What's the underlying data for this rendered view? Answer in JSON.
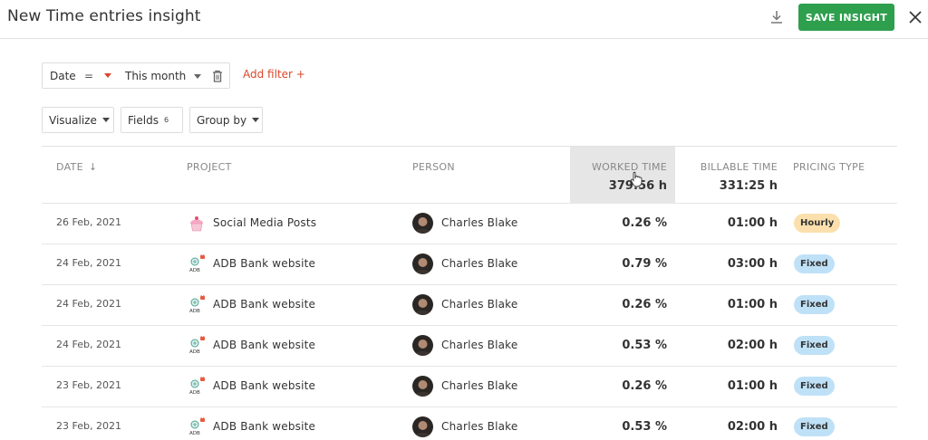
{
  "header": {
    "title": "New Time entries insight",
    "save_label": "SAVE INSIGHT",
    "download_icon": "download-icon",
    "close_icon": "close-icon"
  },
  "filter": {
    "field": "Date",
    "operator": "=",
    "value": "This month",
    "add_filter_label": "Add filter +"
  },
  "toolbar": {
    "visualize_label": "Visualize",
    "fields_label": "Fields",
    "fields_count": "6",
    "group_by_label": "Group by"
  },
  "table": {
    "columns": {
      "date": "DATE",
      "project": "PROJECT",
      "person": "PERSON",
      "worked_time": "WORKED TIME",
      "billable_time": "BILLABLE TIME",
      "pricing_type": "PRICING TYPE"
    },
    "totals": {
      "worked_time": "379:56 h",
      "billable_time": "331:25 h"
    },
    "rows": [
      {
        "date": "26 Feb, 2021",
        "project": "Social Media Posts",
        "project_icon": "cupcake-icon",
        "person": "Charles Blake",
        "worked": "0.26 %",
        "billable": "01:00 h",
        "pricing": "Hourly"
      },
      {
        "date": "24 Feb, 2021",
        "project": "ADB Bank website",
        "project_icon": "adb-logo-icon",
        "person": "Charles Blake",
        "worked": "0.79 %",
        "billable": "03:00 h",
        "pricing": "Fixed"
      },
      {
        "date": "24 Feb, 2021",
        "project": "ADB Bank website",
        "project_icon": "adb-logo-icon",
        "person": "Charles Blake",
        "worked": "0.26 %",
        "billable": "01:00 h",
        "pricing": "Fixed"
      },
      {
        "date": "24 Feb, 2021",
        "project": "ADB Bank website",
        "project_icon": "adb-logo-icon",
        "person": "Charles Blake",
        "worked": "0.53 %",
        "billable": "02:00 h",
        "pricing": "Fixed"
      },
      {
        "date": "23 Feb, 2021",
        "project": "ADB Bank website",
        "project_icon": "adb-logo-icon",
        "person": "Charles Blake",
        "worked": "0.26 %",
        "billable": "01:00 h",
        "pricing": "Fixed"
      },
      {
        "date": "23 Feb, 2021",
        "project": "ADB Bank website",
        "project_icon": "adb-logo-icon",
        "person": "Charles Blake",
        "worked": "0.53 %",
        "billable": "02:00 h",
        "pricing": "Fixed"
      }
    ]
  },
  "colors": {
    "save_button": "#2e9f4d",
    "accent": "#d9472b",
    "hourly_badge": "#fbe0ad",
    "fixed_badge": "#bfe1f7",
    "highlight_column": "#e6e6e6"
  }
}
